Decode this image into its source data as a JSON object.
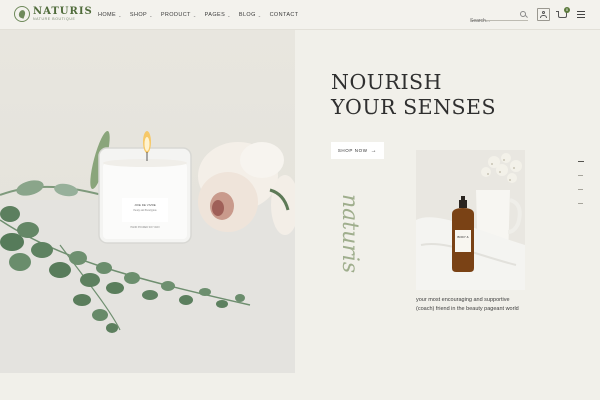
{
  "brand": {
    "name": "NATURIS",
    "tagline": "NATURE BOUTIQUE"
  },
  "nav": {
    "items": [
      {
        "label": "HOME",
        "dropdown": true
      },
      {
        "label": "SHOP",
        "dropdown": true
      },
      {
        "label": "PRODUCT",
        "dropdown": true
      },
      {
        "label": "PAGES",
        "dropdown": true
      },
      {
        "label": "BLOG",
        "dropdown": true
      },
      {
        "label": "CONTACT",
        "dropdown": false
      }
    ]
  },
  "search": {
    "placeholder": "Search..."
  },
  "cart": {
    "count": "0"
  },
  "hero": {
    "headline_line1": "NOURISH",
    "headline_line2": "YOUR SENSES",
    "cta_label": "SHOP NOW",
    "script_text": "naturis",
    "candle_label_line1": "JOIE DE VIVRE",
    "candle_label_line2": "Peony and Eucalyptus",
    "candle_label_line3": "HAND POURED SOY WAX",
    "bottle_label": "BODY &"
  },
  "promo": {
    "caption": "your most encouraging and supportive (coach) friend in the beauty pageant world"
  },
  "slider": {
    "total": 4,
    "active": 1
  },
  "colors": {
    "background": "#f1f0ea",
    "accent_green": "#5b7a3c",
    "text_dark": "#2f2f2f",
    "script_green": "#9fae8d"
  }
}
